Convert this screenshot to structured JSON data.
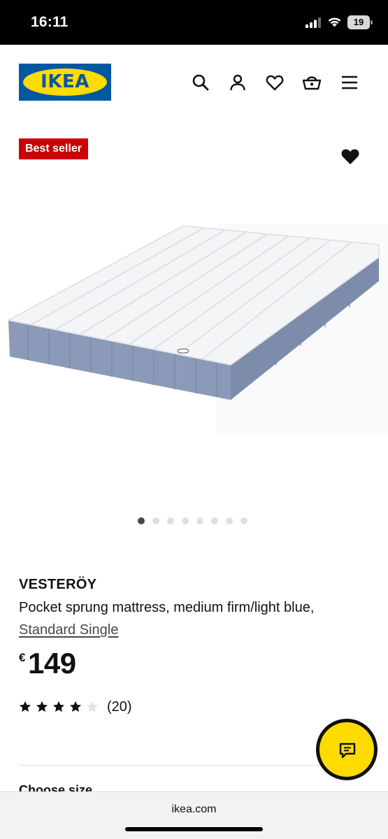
{
  "status_bar": {
    "time": "16:11",
    "battery_level": "19",
    "icons": [
      "signal-icon",
      "wifi-icon",
      "battery-icon"
    ]
  },
  "header": {
    "logo_text": "IKEA",
    "icons": [
      "search-icon",
      "user-icon",
      "heart-icon",
      "basket-icon",
      "menu-icon"
    ],
    "colors": {
      "brand_blue": "#0058a3",
      "brand_yellow": "#ffdb00"
    }
  },
  "product": {
    "badge": "Best seller",
    "badge_color": "#cc0008",
    "image_alt_icon": "mattress-image",
    "carousel": {
      "count": 8,
      "active_index": 0
    },
    "name": "VESTERÖY",
    "description": "Pocket sprung mattress, medium firm/light blue,",
    "size": "Standard Single",
    "currency": "€",
    "price": "149",
    "rating": {
      "stars_filled": 4,
      "stars_total": 5,
      "review_count": "(20)"
    },
    "next_section_peek": "Choose size"
  },
  "chat": {
    "icon": "chat-icon",
    "color": "#ffdb00"
  },
  "browser": {
    "url": "ikea.com"
  }
}
